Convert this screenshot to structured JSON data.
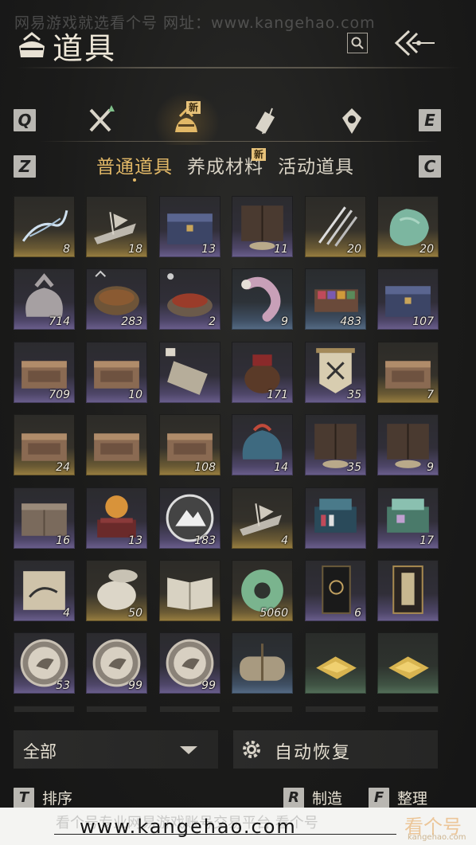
{
  "watermark_top": "网易游戏就选看个号  网址：www.kangehao.com",
  "header": {
    "title": "道具"
  },
  "category_keys": {
    "left": "Q",
    "right": "E"
  },
  "categories": [
    {
      "icon": "crossed-swords-icon",
      "active": false,
      "new": false
    },
    {
      "icon": "bundle-bag-icon",
      "active": true,
      "new": true
    },
    {
      "icon": "scroll-quill-icon",
      "active": false,
      "new": false
    },
    {
      "icon": "gem-drop-icon",
      "active": false,
      "new": false
    }
  ],
  "new_badge": "新",
  "subtab_keys": {
    "left": "Z",
    "right": "C"
  },
  "subtabs": [
    {
      "label": "普通道具",
      "active": true,
      "new": false
    },
    {
      "label": "养成材料",
      "active": false,
      "new": true
    },
    {
      "label": "活动道具",
      "active": false,
      "new": false
    }
  ],
  "items": [
    {
      "name": "spirit-smoke-item",
      "count": "8",
      "rarity": "gold"
    },
    {
      "name": "ink-boat-item",
      "count": "18",
      "rarity": "gold"
    },
    {
      "name": "blue-chest-item",
      "count": "13",
      "rarity": "purple"
    },
    {
      "name": "dark-cabinet-item",
      "count": "11",
      "rarity": "purple"
    },
    {
      "name": "silver-claws-item",
      "count": "20",
      "rarity": "gold"
    },
    {
      "name": "jade-stone-item",
      "count": "20",
      "rarity": "gold"
    },
    {
      "name": "cloth-pouch-item",
      "count": "714",
      "rarity": "purple"
    },
    {
      "name": "stew-pot-item",
      "count": "283",
      "rarity": "purple"
    },
    {
      "name": "meat-bowl-item",
      "count": "2",
      "rarity": "purple"
    },
    {
      "name": "bone-meat-item",
      "count": "9",
      "rarity": "blue"
    },
    {
      "name": "spice-box-item",
      "count": "483",
      "rarity": "blue"
    },
    {
      "name": "blue-chest-item",
      "count": "107",
      "rarity": "purple"
    },
    {
      "name": "carved-box-item",
      "count": "709",
      "rarity": "purple"
    },
    {
      "name": "carved-box-item",
      "count": "10",
      "rarity": "purple"
    },
    {
      "name": "paper-note-item",
      "count": "",
      "rarity": "purple"
    },
    {
      "name": "wine-jar-item",
      "count": "171",
      "rarity": "purple"
    },
    {
      "name": "war-banner-item",
      "count": "35",
      "rarity": "purple"
    },
    {
      "name": "carved-box-item",
      "count": "7",
      "rarity": "gold"
    },
    {
      "name": "carved-box-item",
      "count": "24",
      "rarity": "gold"
    },
    {
      "name": "carved-box-item",
      "count": "",
      "rarity": "gold"
    },
    {
      "name": "carved-box-item",
      "count": "108",
      "rarity": "gold"
    },
    {
      "name": "gift-bundle-item",
      "count": "14",
      "rarity": "purple"
    },
    {
      "name": "dark-cabinet-item",
      "count": "35",
      "rarity": "purple"
    },
    {
      "name": "dark-cabinet-item",
      "count": "9",
      "rarity": "purple"
    },
    {
      "name": "wooden-crate-item",
      "count": "16",
      "rarity": "purple"
    },
    {
      "name": "orb-pedestal-item",
      "count": "13",
      "rarity": "purple"
    },
    {
      "name": "mountain-token-item",
      "count": "183",
      "rarity": "purple"
    },
    {
      "name": "ink-boat-item",
      "count": "4",
      "rarity": "gold"
    },
    {
      "name": "blue-giftbox-item",
      "count": "",
      "rarity": "purple"
    },
    {
      "name": "green-giftbox-item",
      "count": "17",
      "rarity": "purple"
    },
    {
      "name": "ink-scroll-item",
      "count": "4",
      "rarity": "purple"
    },
    {
      "name": "porcelain-jar-item",
      "count": "50",
      "rarity": "gold"
    },
    {
      "name": "open-book-item",
      "count": "",
      "rarity": "gold"
    },
    {
      "name": "jade-ring-item",
      "count": "5060",
      "rarity": "gold"
    },
    {
      "name": "black-card-item",
      "count": "6",
      "rarity": "purple"
    },
    {
      "name": "talisman-card-item",
      "count": "",
      "rarity": "purple"
    },
    {
      "name": "bird-coin-item",
      "count": "53",
      "rarity": "purple"
    },
    {
      "name": "bird-coin-item",
      "count": "99",
      "rarity": "purple"
    },
    {
      "name": "bird-coin-item",
      "count": "99",
      "rarity": "purple"
    },
    {
      "name": "sack-bundle-item",
      "count": "",
      "rarity": "blue"
    },
    {
      "name": "gold-ingot-item",
      "count": "",
      "rarity": "green"
    },
    {
      "name": "gold-ingot-item",
      "count": "",
      "rarity": "green"
    },
    {
      "name": "empty-slot",
      "count": "",
      "rarity": "empty"
    },
    {
      "name": "empty-slot",
      "count": "",
      "rarity": "empty"
    },
    {
      "name": "empty-slot",
      "count": "",
      "rarity": "empty"
    },
    {
      "name": "empty-slot",
      "count": "",
      "rarity": "empty"
    },
    {
      "name": "empty-slot",
      "count": "",
      "rarity": "empty"
    },
    {
      "name": "empty-slot",
      "count": "",
      "rarity": "empty"
    }
  ],
  "filter": {
    "label": "全部"
  },
  "auto_restore": {
    "label": "自动恢复"
  },
  "actions": {
    "sort": {
      "key": "T",
      "label": "排序"
    },
    "craft": {
      "key": "R",
      "label": "制造"
    },
    "organize": {
      "key": "F",
      "label": "整理"
    }
  },
  "footer": {
    "faded": "看个号专业网易游戏账号交易平台 看个号",
    "url": "www.kangehao.com",
    "logo": "看个号",
    "logo_sub": "kangehao.com"
  },
  "colors": {
    "accent": "#e2b867",
    "badge": "#e7c27a",
    "key": "#b9b7b2"
  }
}
